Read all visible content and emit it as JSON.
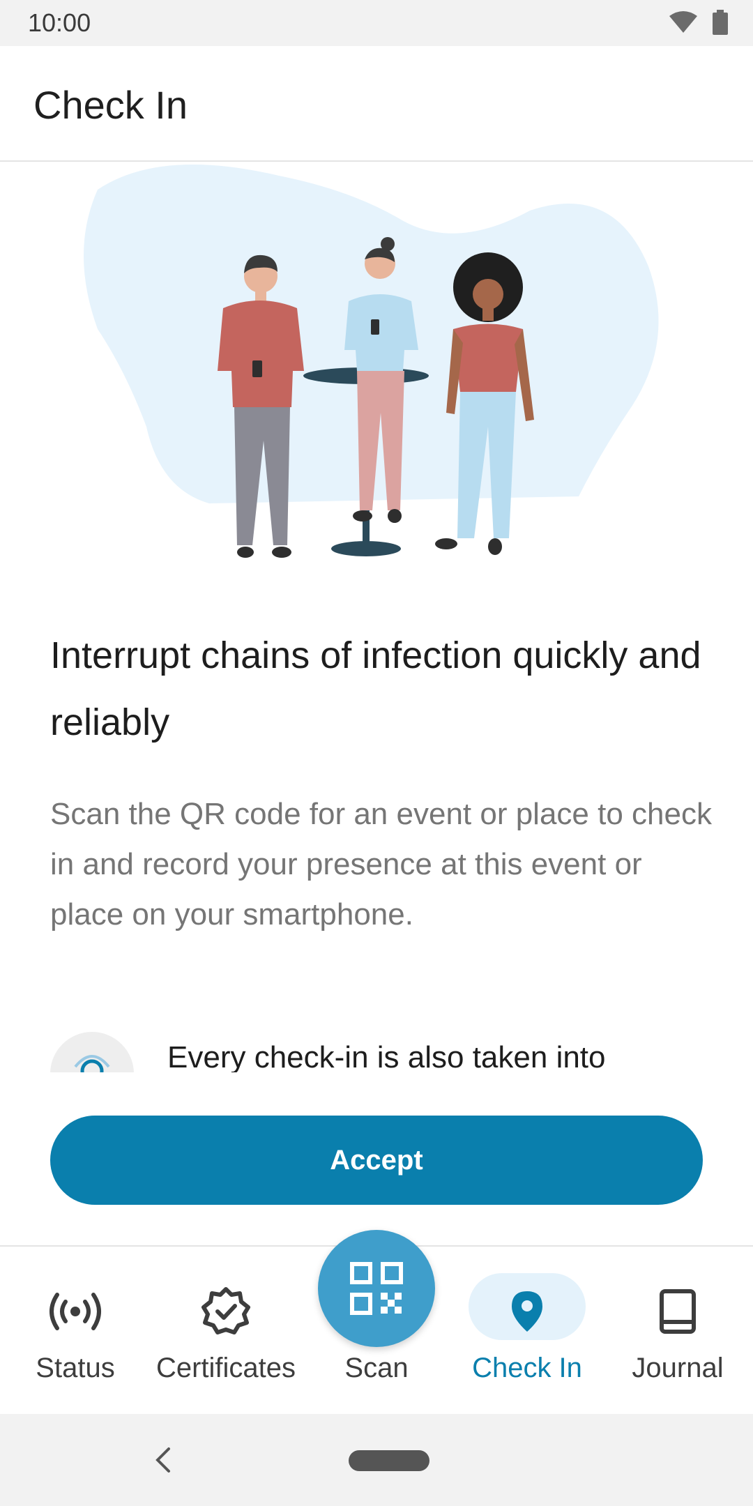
{
  "status_bar": {
    "time": "10:00"
  },
  "app_bar": {
    "title": "Check In"
  },
  "content": {
    "headline": "Interrupt chains of infection quickly and reliably",
    "body": "Scan the QR code for an event or place to check in and record your presence at this event or place on your smartphone.",
    "feature_text": "Every check-in is also taken into"
  },
  "accept_button": {
    "label": "Accept"
  },
  "bottom_nav": {
    "items": [
      {
        "label": "Status",
        "icon": "broadcast-icon"
      },
      {
        "label": "Certificates",
        "icon": "badge-check-icon"
      },
      {
        "label": "Scan",
        "icon": "qr-code-icon"
      },
      {
        "label": "Check In",
        "icon": "location-pin-icon",
        "active": true
      },
      {
        "label": "Journal",
        "icon": "book-icon"
      }
    ]
  },
  "colors": {
    "accent": "#0a7fad",
    "fab": "#3f9ecb",
    "active_pill": "#e4f2fb",
    "illustration_bg": "#e6f3fc"
  }
}
